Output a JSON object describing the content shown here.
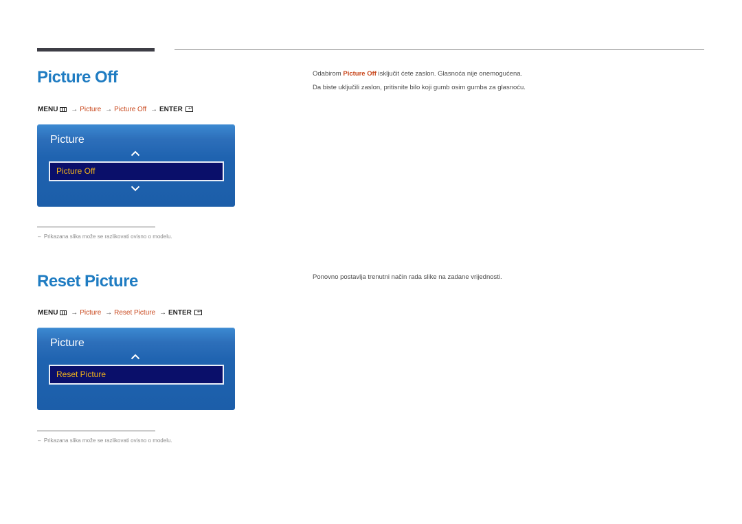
{
  "sections": [
    {
      "title": "Picture Off",
      "menu_path": {
        "menu": "MENU",
        "menu_icon": "menu-icon",
        "arrow": "→",
        "step1": "Picture",
        "step2": "Picture Off",
        "enter": "ENTER",
        "enter_icon": "enter-icon"
      },
      "osd": {
        "title": "Picture",
        "selected_item": "Picture Off",
        "has_up_chevron": true,
        "has_down_chevron": true
      },
      "description": {
        "line1_prefix": "Odabirom ",
        "line1_highlight": "Picture Off",
        "line1_suffix": " isključit ćete zaslon. Glasnoća nije onemogućena.",
        "line2": "Da biste uključili zaslon, pritisnite bilo koji gumb osim gumba za glasnoću."
      },
      "footnote": {
        "dash": "–",
        "text": "Prikazana slika može se razlikovati ovisno o modelu."
      }
    },
    {
      "title": "Reset Picture",
      "menu_path": {
        "menu": "MENU",
        "menu_icon": "menu-icon",
        "arrow": "→",
        "step1": "Picture",
        "step2": "Reset Picture",
        "enter": "ENTER",
        "enter_icon": "enter-icon"
      },
      "osd": {
        "title": "Picture",
        "selected_item": "Reset Picture",
        "has_up_chevron": true,
        "has_down_chevron": false
      },
      "description": {
        "line1": "Ponovno postavlja trenutni način rada slike na zadane vrijednosti."
      },
      "footnote": {
        "dash": "–",
        "text": "Prikazana slika može se razlikovati ovisno o modelu."
      }
    }
  ],
  "colors": {
    "title_blue": "#1f7cc2",
    "highlight_orange": "#c8461b",
    "osd_blue": "#1f63b0",
    "osd_selected_bg": "#0a0f6a",
    "osd_selected_text": "#f4b41a"
  }
}
